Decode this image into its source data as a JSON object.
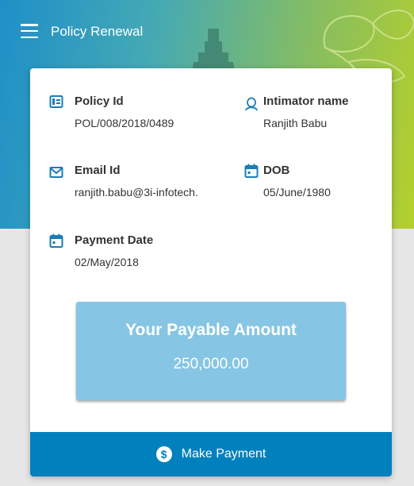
{
  "appbar": {
    "title": "Policy Renewal",
    "menu_icon": "hamburger-menu-icon"
  },
  "fields": {
    "policy_id": {
      "label": "Policy Id",
      "value": "POL/008/2018/0489",
      "icon": "id-card-icon"
    },
    "intimator_name": {
      "label": "Intimator name",
      "value": "Ranjith Babu",
      "icon": "person-icon"
    },
    "email_id": {
      "label": "Email Id",
      "value": "ranjith.babu@3i-infotech.",
      "icon": "mail-icon"
    },
    "dob": {
      "label": "DOB",
      "value": "05/June/1980",
      "icon": "calendar-icon"
    },
    "payment_date": {
      "label": "Payment Date",
      "value": "02/May/2018",
      "icon": "calendar-icon"
    }
  },
  "amount": {
    "title": "Your Payable Amount",
    "value": "250,000.00"
  },
  "payment": {
    "label": "Make Payment",
    "icon": "dollar-circle-icon",
    "icon_glyph": "$"
  },
  "colors": {
    "accent": "#0080bd",
    "amount_box": "#86c5e3",
    "icon": "#1a7db7"
  }
}
